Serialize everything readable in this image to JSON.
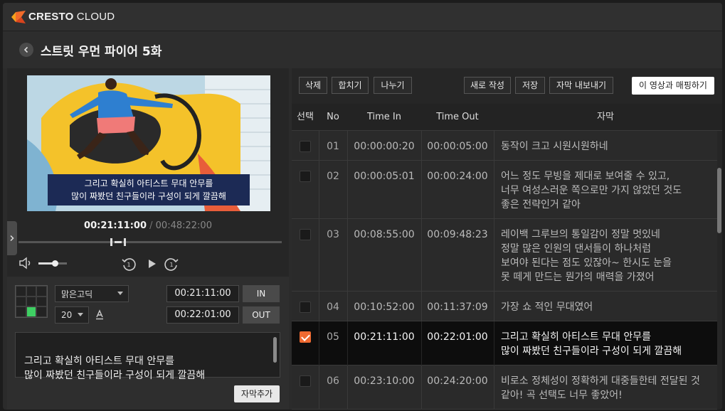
{
  "app": {
    "brand_bold": "CRESTO",
    "brand_light": " CLOUD",
    "brand_color": "#f26b2a"
  },
  "header": {
    "title": "스트릿 우먼 파이어 5화",
    "back_icon": "chevron-left-icon"
  },
  "player": {
    "caption_lines": "그리고 확실히 아티스트 무대 안무를\n많이 짜봤던 친구들이라 구성이 되게 깔끔해",
    "current_time": "00:21:11:00",
    "separator": " / ",
    "total_time": "00:48:22:00",
    "progress_fraction": 0.44,
    "volume_fraction": 0.6
  },
  "editor": {
    "position_grid": [
      false,
      false,
      false,
      false,
      false,
      false,
      false,
      true,
      false
    ],
    "font_name": "맑은고딕",
    "font_size": "20",
    "in_time": "00:21:11:00",
    "out_time": "00:22:01:00",
    "in_label": "IN",
    "out_label": "OUT",
    "subtitle_text": "그리고 확실히 아티스트 무대 안무를\n많이 짜봤던 친구들이라 구성이 되게 깔끔해",
    "add_label": "자막추가"
  },
  "toolbar": {
    "delete_label": "삭제",
    "merge_label": "합치기",
    "split_label": "나누기",
    "new_label": "새로 작성",
    "save_label": "저장",
    "export_label": "자막 내보내기",
    "map_label": "이 영상과 매핑하기"
  },
  "table": {
    "headers": {
      "select": "선택",
      "no": "No",
      "time_in": "Time In",
      "time_out": "Time Out",
      "subtitle": "자막"
    },
    "rows": [
      {
        "no": "01",
        "time_in": "00:00:00:20",
        "time_out": "00:00:05:00",
        "text": "동작이 크고 시원시원하네",
        "selected": false
      },
      {
        "no": "02",
        "time_in": "00:00:05:01",
        "time_out": "00:00:24:00",
        "text": "어느 정도 무빙을 제대로 보여줄 수 있고,\n너무 여성스러운 쪽으로만 가지 않았던 것도\n좋은 전략인거 같아",
        "selected": false
      },
      {
        "no": "03",
        "time_in": "00:08:55:00",
        "time_out": "00:09:48:23",
        "text": "레이백 그루브의 통일감이 정말 멋있네\n정말 많은 인원의 댄서들이 하나처럼\n보여야 된다는 점도 있잖아~ 한시도 눈을\n못 떼게 만드는 뭔가의 매력을 가졌어",
        "selected": false
      },
      {
        "no": "04",
        "time_in": "00:10:52:00",
        "time_out": "00:11:37:09",
        "text": "가장 쇼 적인 무대였어",
        "selected": false
      },
      {
        "no": "05",
        "time_in": "00:21:11:00",
        "time_out": "00:22:01:00",
        "text": "그리고 확실히 아티스트 무대 안무를\n많이 짜봤던 친구들이라 구성이 되게 깔끔해",
        "selected": true
      },
      {
        "no": "06",
        "time_in": "00:23:10:00",
        "time_out": "00:24:20:00",
        "text": "비로소 정체성이 정확하게 대중들한테 전달된 것\n같아! 곡 선택도 너무 좋았어!",
        "selected": false
      }
    ]
  },
  "colors": {
    "accent": "#ef6a31",
    "caption_bg": "#1c2a55",
    "grid_on": "#3fcf63"
  }
}
